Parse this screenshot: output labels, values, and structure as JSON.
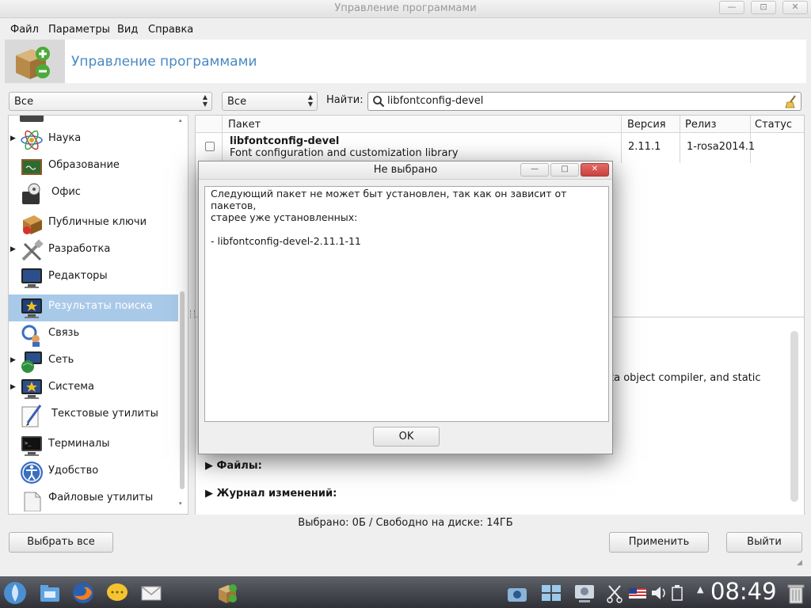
{
  "window": {
    "title": "Управление программами",
    "controls": {
      "minimize": "—",
      "maximize": "⊡",
      "close": "✕"
    }
  },
  "menubar": {
    "items": [
      "Файл",
      "Параметры",
      "Вид",
      "Справка"
    ]
  },
  "header": {
    "title": "Управление программами",
    "logo_icon": "package-add-remove-icon"
  },
  "filters": {
    "type_combo": "Все",
    "status_combo": "Все",
    "find_label": "Найти:",
    "search_value": "libfontconfig-devel"
  },
  "categories": [
    {
      "label": "Наука",
      "icon": "science-icon",
      "expandable": true
    },
    {
      "label": "Образование",
      "icon": "education-icon",
      "expandable": false
    },
    {
      "label": "Офис",
      "icon": "office-icon",
      "expandable": false
    },
    {
      "label": "Публичные ключи",
      "icon": "public-keys-icon",
      "expandable": false
    },
    {
      "label": "Разработка",
      "icon": "development-icon",
      "expandable": true
    },
    {
      "label": "Редакторы",
      "icon": "editors-icon",
      "expandable": false
    },
    {
      "label": "Результаты поиска",
      "icon": "search-results-icon",
      "expandable": false,
      "selected": true
    },
    {
      "label": "Связь",
      "icon": "communication-icon",
      "expandable": false
    },
    {
      "label": "Сеть",
      "icon": "network-icon",
      "expandable": true
    },
    {
      "label": "Система",
      "icon": "system-icon",
      "expandable": true
    },
    {
      "label": "Текстовые утилиты",
      "icon": "text-utilities-icon",
      "expandable": false
    },
    {
      "label": "Терминалы",
      "icon": "terminals-icon",
      "expandable": false
    },
    {
      "label": "Удобство",
      "icon": "accessibility-icon",
      "expandable": false
    },
    {
      "label": "Файловые утилиты",
      "icon": "file-utilities-icon",
      "expandable": false
    }
  ],
  "package_table": {
    "columns": [
      "Пакет",
      "Версия",
      "Релиз",
      "Статус"
    ],
    "rows": [
      {
        "name": "libfontconfig-devel",
        "summary": "Font configuration and customization library",
        "version": "2.11.1",
        "release": "1-rosa2014.1",
        "checked": false
      }
    ]
  },
  "details": {
    "partial_text": "ta object compiler, and static",
    "files_label": "Файлы:",
    "changelog_label": "Журнал изменений:"
  },
  "status_text": "Выбрано: 0Б / Свободно на диске: 14ГБ",
  "buttons": {
    "select_all": "Выбрать все",
    "apply": "Применить",
    "exit": "Выйти"
  },
  "dialog": {
    "title": "Не выбрано",
    "message_line1": "Следующий пакет не может быт установлен, так как он зависит от пакетов,",
    "message_line2": "старее уже установленных:",
    "package_line": "- libfontconfig-devel-2.11.1-11",
    "ok_label": "OK",
    "controls": {
      "minimize": "—",
      "maximize": "□",
      "close": "✕"
    }
  },
  "taskbar": {
    "clock": "08:49",
    "launchers": [
      "rosa-launcher-icon",
      "file-manager-icon",
      "firefox-icon",
      "messenger-icon",
      "mail-icon",
      "software-manager-icon"
    ],
    "tray": [
      "screenshot-icon",
      "window-switcher-icon",
      "network-tray-icon",
      "clipboard-icon",
      "keyboard-layout-us-icon",
      "volume-icon",
      "battery-icon",
      "notifications-icon",
      "trash-icon"
    ]
  },
  "colors": {
    "accent": "#4a89c0",
    "selection": "#a9c9e8",
    "close_red": "#d9534f",
    "taskbar": "#3a3c42"
  }
}
